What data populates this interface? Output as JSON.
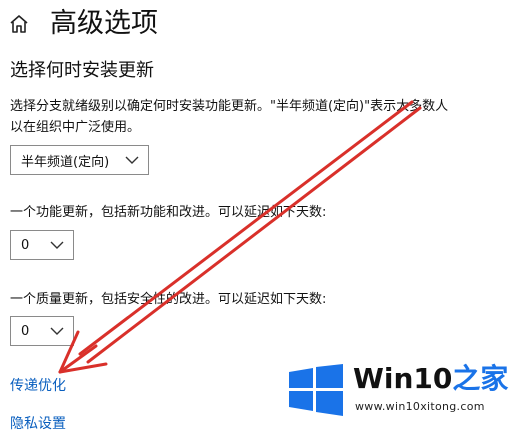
{
  "header": {
    "title": "高级选项",
    "home_icon": "home-icon"
  },
  "section": {
    "title": "选择何时安装更新",
    "description_line1": "选择分支就绪级别以确定何时安装功能更新。\"半年频道(定向)\"表示大多数人",
    "description_line2": "以在组织中广泛使用。"
  },
  "branch_select": {
    "value": "半年频道(定向)"
  },
  "feature_update": {
    "label": "一个功能更新，包括新功能和改进。可以延迟如下天数:",
    "value": "0"
  },
  "quality_update": {
    "label": "一个质量更新，包括安全性的改进。可以延迟如下天数:",
    "value": "0"
  },
  "links": {
    "delivery_optimization": "传递优化",
    "privacy_settings": "隐私设置"
  },
  "watermark": {
    "title_prefix": "Win10",
    "title_suffix": "之家",
    "url": "www.win10xitong.com"
  },
  "colors": {
    "link": "#0a5fbf",
    "arrow": "#d9302a",
    "logo_blue": "#1a73e8",
    "background": "#ffffff"
  }
}
